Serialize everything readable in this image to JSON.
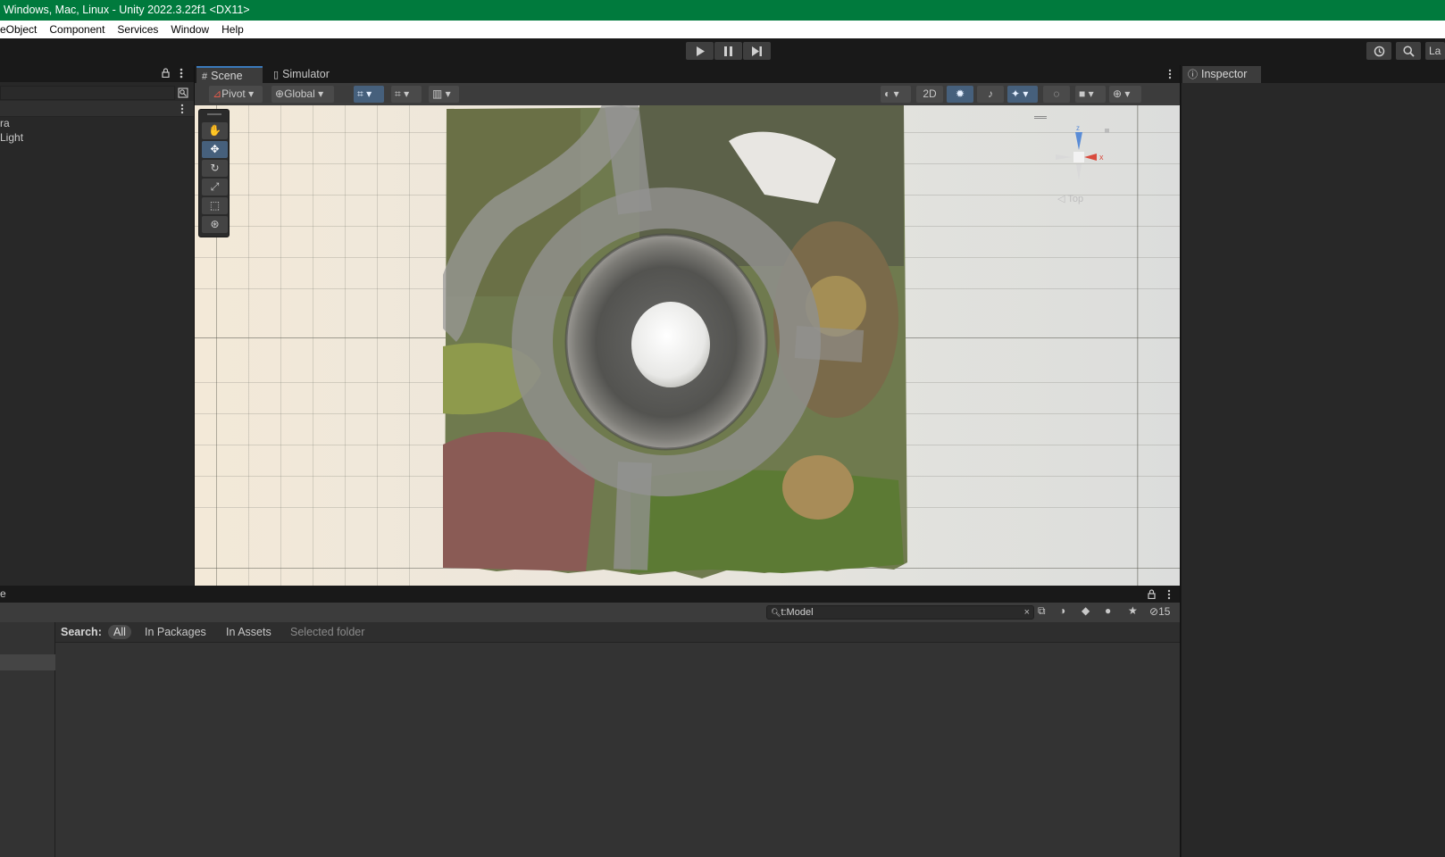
{
  "window": {
    "title": "Windows, Mac, Linux - Unity 2022.3.22f1 <DX11>"
  },
  "menubar": {
    "items": [
      "eObject",
      "Component",
      "Services",
      "Window",
      "Help"
    ]
  },
  "toolbar": {
    "right_partial": "La"
  },
  "hierarchy": {
    "items": [
      "ra",
      "Light"
    ]
  },
  "scene_tabs": [
    {
      "label": "Scene",
      "icon": "grid-icon"
    },
    {
      "label": "Simulator",
      "icon": "simulator-icon"
    }
  ],
  "scene_toolbar": {
    "pivot": "Pivot",
    "global": "Global",
    "mode_2d": "2D"
  },
  "gizmo": {
    "view_label": "Top"
  },
  "inspector": {
    "tab_label": "Inspector"
  },
  "project": {
    "tab_partial": "e",
    "search_value": "t:Model",
    "hidden_count": "15",
    "search_label": "Search:",
    "filters": [
      "All",
      "In Packages",
      "In Assets",
      "Selected folder"
    ]
  },
  "colors": {
    "title_bar": "#007a3d",
    "accent": "#3a79bb",
    "selected": "#46607c"
  }
}
